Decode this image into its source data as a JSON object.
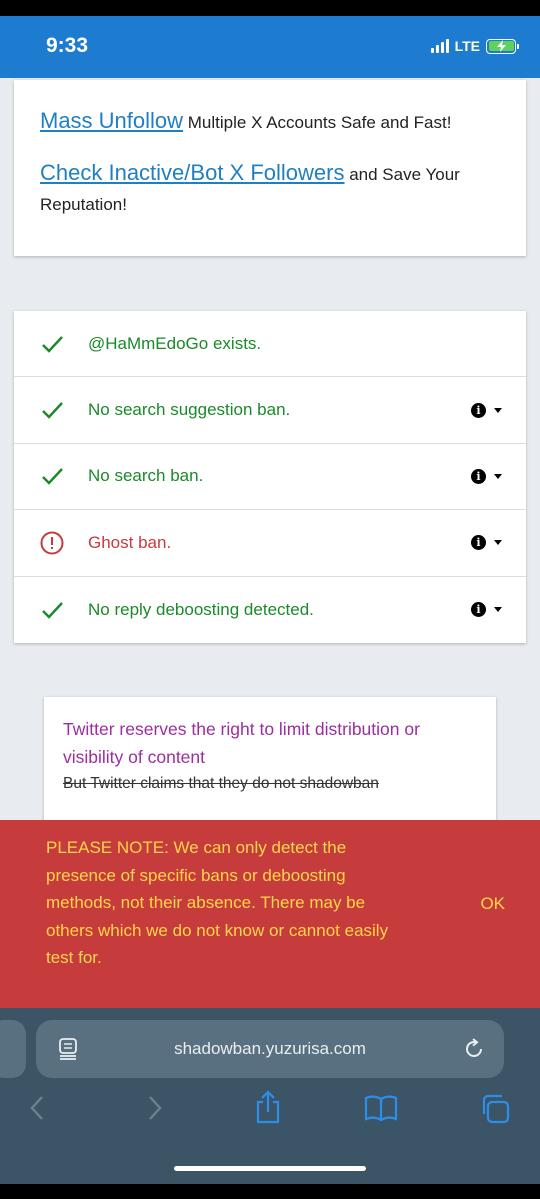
{
  "status_bar": {
    "time": "9:33",
    "network": "LTE"
  },
  "promo": {
    "link1": "Mass Unfollow",
    "text1": " Multiple X Accounts Safe and Fast!",
    "link2a": "Check Inactive",
    "slash": "/",
    "link2b": "Bot X Followers",
    "text2": " and Save Your Reputation!"
  },
  "results": [
    {
      "text": "@HaMmEdoGo exists.",
      "status": "ok"
    },
    {
      "text": "No search suggestion ban.",
      "status": "ok"
    },
    {
      "text": "No search ban.",
      "status": "ok"
    },
    {
      "text": "Ghost ban.",
      "status": "bad"
    },
    {
      "text": "No reply deboosting detected.",
      "status": "ok"
    }
  ],
  "note": {
    "purple": "Twitter reserves the right to limit distribution or visibility of content",
    "strike": "But Twitter claims that they do not shadowban"
  },
  "banner": {
    "message": "PLEASE NOTE: We can only detect the presence of specific bans or deboosting methods, not their absence. There may be others which we do not know or cannot easily test for.",
    "ok_label": "OK"
  },
  "browser": {
    "url": "shadowban.yuzurisa.com"
  },
  "colors": {
    "status_bar": "#1d7bd0",
    "link": "#1f7fc4",
    "ok_green": "#1a8a2a",
    "bad_red": "#c43c3c",
    "banner_red": "#c63c3c",
    "banner_text": "#ffd54a",
    "note_purple": "#9c2ea0"
  }
}
